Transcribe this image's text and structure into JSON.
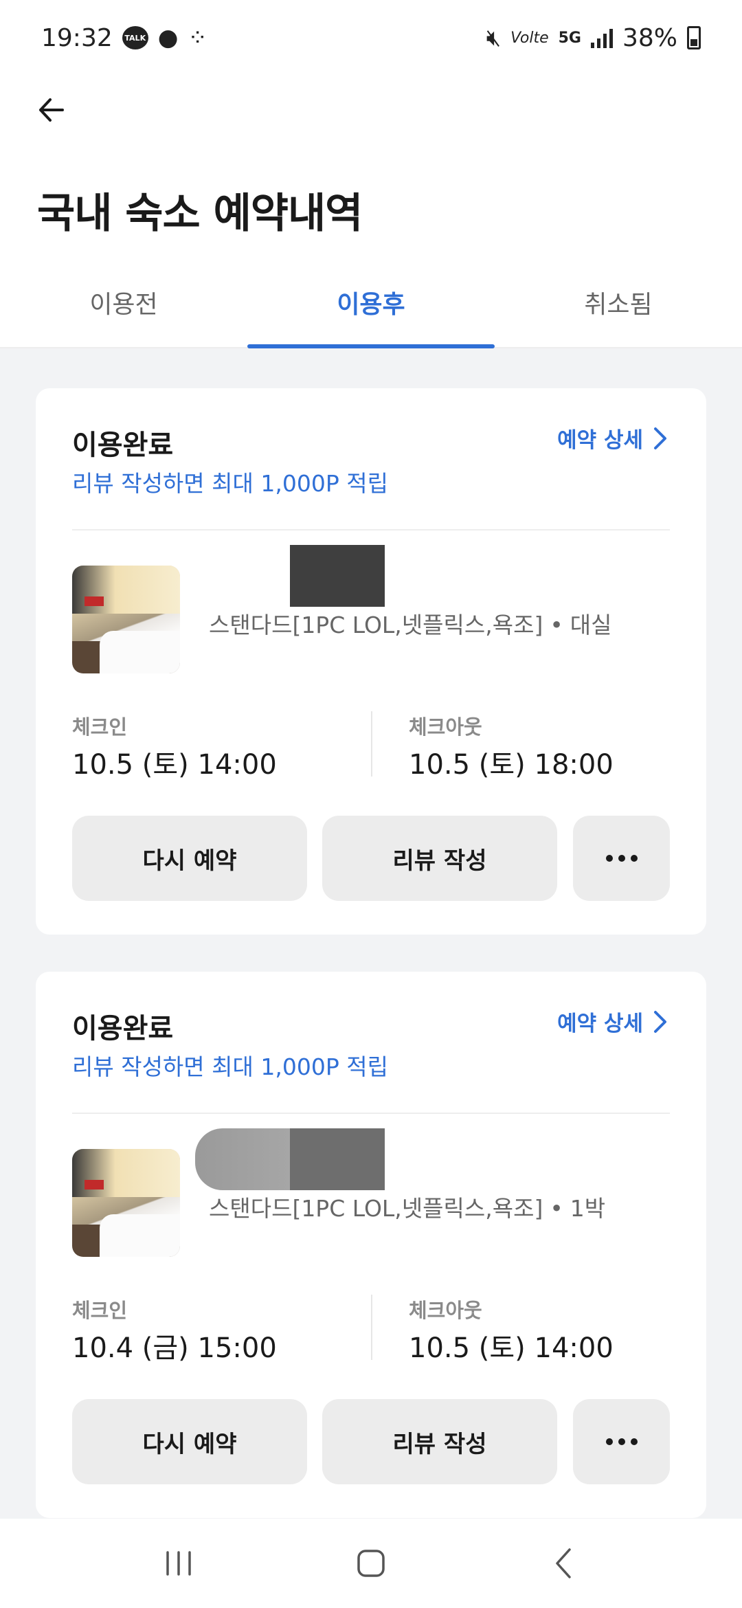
{
  "status_bar": {
    "time": "19:32",
    "battery": "38%",
    "network": "5G",
    "volte": "Volte"
  },
  "header": {
    "title": "국내 숙소 예약내역"
  },
  "tabs": [
    {
      "label": "이용전",
      "active": false
    },
    {
      "label": "이용후",
      "active": true
    },
    {
      "label": "취소됨",
      "active": false
    }
  ],
  "bookings": [
    {
      "status": "이용완료",
      "subtext": "리뷰 작성하면 최대 1,000P 적립",
      "detail_link": "예약 상세",
      "room": "스탠다드[1PC LOL,넷플릭스,욕조]",
      "stay_type": "대실",
      "checkin_label": "체크인",
      "checkin_value": "10.5 (토) 14:00",
      "checkout_label": "체크아웃",
      "checkout_value": "10.5 (토) 18:00",
      "rebook_label": "다시 예약",
      "review_label": "리뷰 작성"
    },
    {
      "status": "이용완료",
      "subtext": "리뷰 작성하면 최대 1,000P 적립",
      "detail_link": "예약 상세",
      "room": "스탠다드[1PC LOL,넷플릭스,욕조]",
      "stay_type": "1박",
      "checkin_label": "체크인",
      "checkin_value": "10.4 (금) 15:00",
      "checkout_label": "체크아웃",
      "checkout_value": "10.5 (토) 14:00",
      "rebook_label": "다시 예약",
      "review_label": "리뷰 작성"
    }
  ],
  "colors": {
    "accent": "#2f6fd6",
    "background": "#f2f3f5",
    "button": "#ececec"
  }
}
